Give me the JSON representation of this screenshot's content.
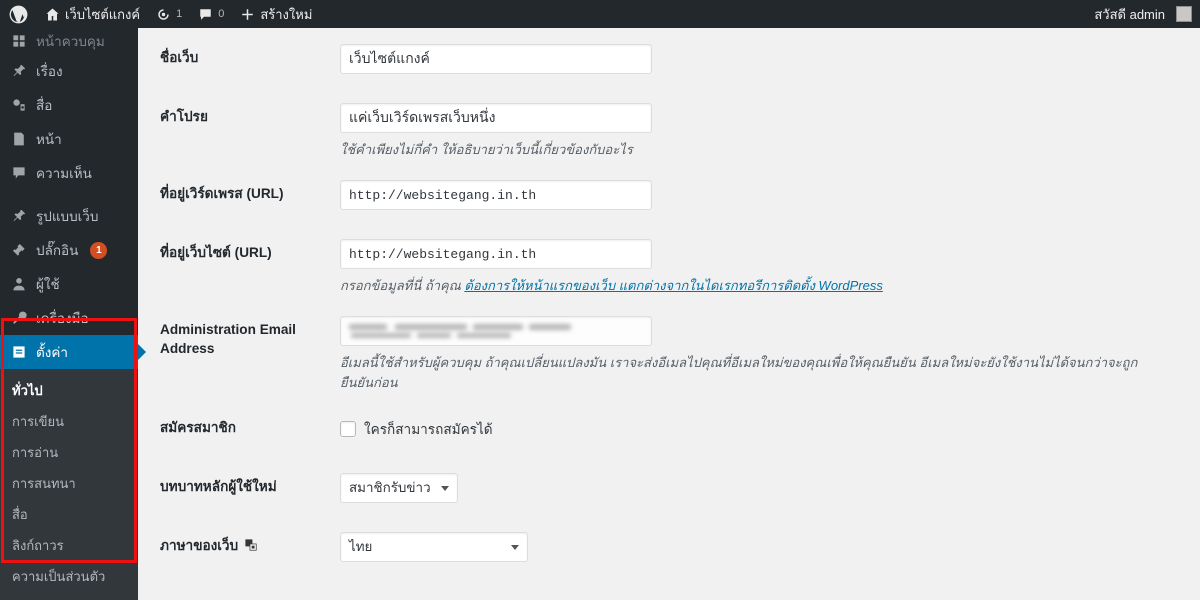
{
  "adminbar": {
    "logo_icon": "wordpress-logo-icon",
    "home_icon": "home-icon",
    "site_name": "เว็บไซต์แกงค์",
    "updates_icon": "updates-icon",
    "updates_count": "1",
    "comments_icon": "comment-bubble-icon",
    "comments_count": "0",
    "new_icon": "plus-icon",
    "new_label": "สร้างใหม่",
    "greeting": "สวัสดี admin",
    "avatar_icon": "avatar-icon"
  },
  "sidebar": {
    "items": [
      {
        "label": "หน้าควบคุม",
        "icon": "dashboard-icon",
        "name": "dashboard"
      },
      {
        "label": "เรื่อง",
        "icon": "pin-icon",
        "name": "posts"
      },
      {
        "label": "สื่อ",
        "icon": "media-icon",
        "name": "media"
      },
      {
        "label": "หน้า",
        "icon": "page-icon",
        "name": "pages"
      },
      {
        "label": "ความเห็น",
        "icon": "comment-icon",
        "name": "comments"
      },
      {
        "label": "รูปแบบเว็บ",
        "icon": "appearance-icon",
        "name": "appearance"
      },
      {
        "label": "ปลั๊กอิน",
        "icon": "plugin-icon",
        "name": "plugins",
        "badge": "1"
      },
      {
        "label": "ผู้ใช้",
        "icon": "user-icon",
        "name": "users"
      },
      {
        "label": "เครื่องมือ",
        "icon": "tools-icon",
        "name": "tools"
      },
      {
        "label": "ตั้งค่า",
        "icon": "settings-icon",
        "name": "settings",
        "current": true
      }
    ],
    "submenu": [
      {
        "label": "ทั่วไป",
        "name": "general",
        "current": true
      },
      {
        "label": "การเขียน",
        "name": "writing"
      },
      {
        "label": "การอ่าน",
        "name": "reading"
      },
      {
        "label": "การสนทนา",
        "name": "discussion"
      },
      {
        "label": "สื่อ",
        "name": "media"
      },
      {
        "label": "ลิงก์ถาวร",
        "name": "permalinks"
      },
      {
        "label": "ความเป็นส่วนตัว",
        "name": "privacy"
      }
    ]
  },
  "annotation": {
    "color": "#ee1111"
  },
  "form": {
    "site_title": {
      "label": "ชื่อเว็บ",
      "value": "เว็บไซต์แกงค์"
    },
    "tagline": {
      "label": "คำโปรย",
      "value": "แค่เว็บเวิร์ดเพรสเว็บหนึ่ง",
      "description": "ใช้คำเพียงไม่กี่คำ ให้อธิบายว่าเว็บนี้เกี่ยวข้องกับอะไร"
    },
    "wp_address": {
      "label": "ที่อยู่เวิร์ดเพรส (URL)",
      "value": "http://websitegang.in.th"
    },
    "site_address": {
      "label": "ที่อยู่เว็บไซต์ (URL)",
      "value": "http://websitegang.in.th",
      "description_before": "กรอกข้อมูลที่นี่ ถ้าคุณ ",
      "link_text": "ต้องการให้หน้าแรกของเว็บ แตกต่างจากในไดเรกทอรีการติดตั้ง WordPress"
    },
    "admin_email": {
      "label": "Administration Email Address",
      "value": "",
      "redacted": true,
      "description": "อีเมลนี้ใช้สำหรับผู้ควบคุม ถ้าคุณเปลี่ยนแปลงมัน เราจะส่งอีเมลไปคุณที่อีเมลใหม่ของคุณเพื่อให้คุณยืนยัน อีเมลใหม่จะยังใช้งานไม่ได้จนกว่าจะถูกยืนยันก่อน"
    },
    "membership": {
      "label": "สมัครสมาชิก",
      "checkbox_label": "ใครก็สามารถสมัครได้",
      "checked": false
    },
    "default_role": {
      "label": "บทบาทหลักผู้ใช้ใหม่",
      "value": "สมาชิกรับข่าว"
    },
    "site_language": {
      "label": "ภาษาของเว็บ",
      "icon": "translate-icon",
      "value": "ไทย"
    }
  }
}
